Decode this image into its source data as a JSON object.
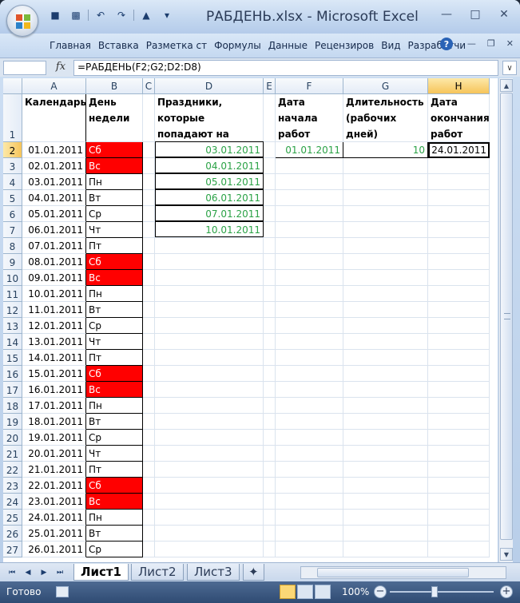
{
  "window": {
    "title": "РАБДЕНЬ.xlsx - Microsoft Excel"
  },
  "ribbon": {
    "tabs": [
      "Главная",
      "Вставка",
      "Разметка ст",
      "Формулы",
      "Данные",
      "Рецензиров",
      "Вид",
      "Разработчи"
    ]
  },
  "formula_bar": {
    "fx_label": "fx",
    "formula": "=РАБДЕНЬ(F2;G2;D2:D8)"
  },
  "columns": [
    "A",
    "B",
    "C",
    "D",
    "E",
    "F",
    "G",
    "H"
  ],
  "rows": [
    "1",
    "2",
    "3",
    "4",
    "5",
    "6",
    "7",
    "8",
    "9",
    "10",
    "11",
    "12",
    "13",
    "14",
    "15",
    "16",
    "17",
    "18",
    "19",
    "20",
    "21",
    "22",
    "23",
    "24",
    "25",
    "26",
    "27"
  ],
  "headers": {
    "A1": "Календарь",
    "B1": "День недели",
    "D1": "Праздники, которые попадают на рабочие дни",
    "F1": "Дата начала работ",
    "G1": "Длительность (рабочих дней)",
    "H1": "Дата окончания работ"
  },
  "calendar": [
    {
      "date": "01.01.2011",
      "day": "Сб",
      "weekend": true
    },
    {
      "date": "02.01.2011",
      "day": "Вс",
      "weekend": true
    },
    {
      "date": "03.01.2011",
      "day": "Пн",
      "weekend": false
    },
    {
      "date": "04.01.2011",
      "day": "Вт",
      "weekend": false
    },
    {
      "date": "05.01.2011",
      "day": "Ср",
      "weekend": false
    },
    {
      "date": "06.01.2011",
      "day": "Чт",
      "weekend": false
    },
    {
      "date": "07.01.2011",
      "day": "Пт",
      "weekend": false
    },
    {
      "date": "08.01.2011",
      "day": "Сб",
      "weekend": true
    },
    {
      "date": "09.01.2011",
      "day": "Вс",
      "weekend": true
    },
    {
      "date": "10.01.2011",
      "day": "Пн",
      "weekend": false
    },
    {
      "date": "11.01.2011",
      "day": "Вт",
      "weekend": false
    },
    {
      "date": "12.01.2011",
      "day": "Ср",
      "weekend": false
    },
    {
      "date": "13.01.2011",
      "day": "Чт",
      "weekend": false
    },
    {
      "date": "14.01.2011",
      "day": "Пт",
      "weekend": false
    },
    {
      "date": "15.01.2011",
      "day": "Сб",
      "weekend": true
    },
    {
      "date": "16.01.2011",
      "day": "Вс",
      "weekend": true
    },
    {
      "date": "17.01.2011",
      "day": "Пн",
      "weekend": false
    },
    {
      "date": "18.01.2011",
      "day": "Вт",
      "weekend": false
    },
    {
      "date": "19.01.2011",
      "day": "Ср",
      "weekend": false
    },
    {
      "date": "20.01.2011",
      "day": "Чт",
      "weekend": false
    },
    {
      "date": "21.01.2011",
      "day": "Пт",
      "weekend": false
    },
    {
      "date": "22.01.2011",
      "day": "Сб",
      "weekend": true
    },
    {
      "date": "23.01.2011",
      "day": "Вс",
      "weekend": true
    },
    {
      "date": "24.01.2011",
      "day": "Пн",
      "weekend": false
    },
    {
      "date": "25.01.2011",
      "day": "Вт",
      "weekend": false
    },
    {
      "date": "26.01.2011",
      "day": "Ср",
      "weekend": false
    }
  ],
  "holidays": [
    "03.01.2011",
    "04.01.2011",
    "05.01.2011",
    "06.01.2011",
    "07.01.2011",
    "10.01.2011"
  ],
  "task": {
    "start": "01.01.2011",
    "duration": "10",
    "end": "24.01.2011"
  },
  "sheets": [
    "Лист1",
    "Лист2",
    "Лист3"
  ],
  "status": {
    "ready": "Готово",
    "zoom": "100%"
  },
  "colors": {
    "weekend_bg": "#ff0000",
    "holiday_text": "#2ba246",
    "selection": "#f6c45a"
  }
}
